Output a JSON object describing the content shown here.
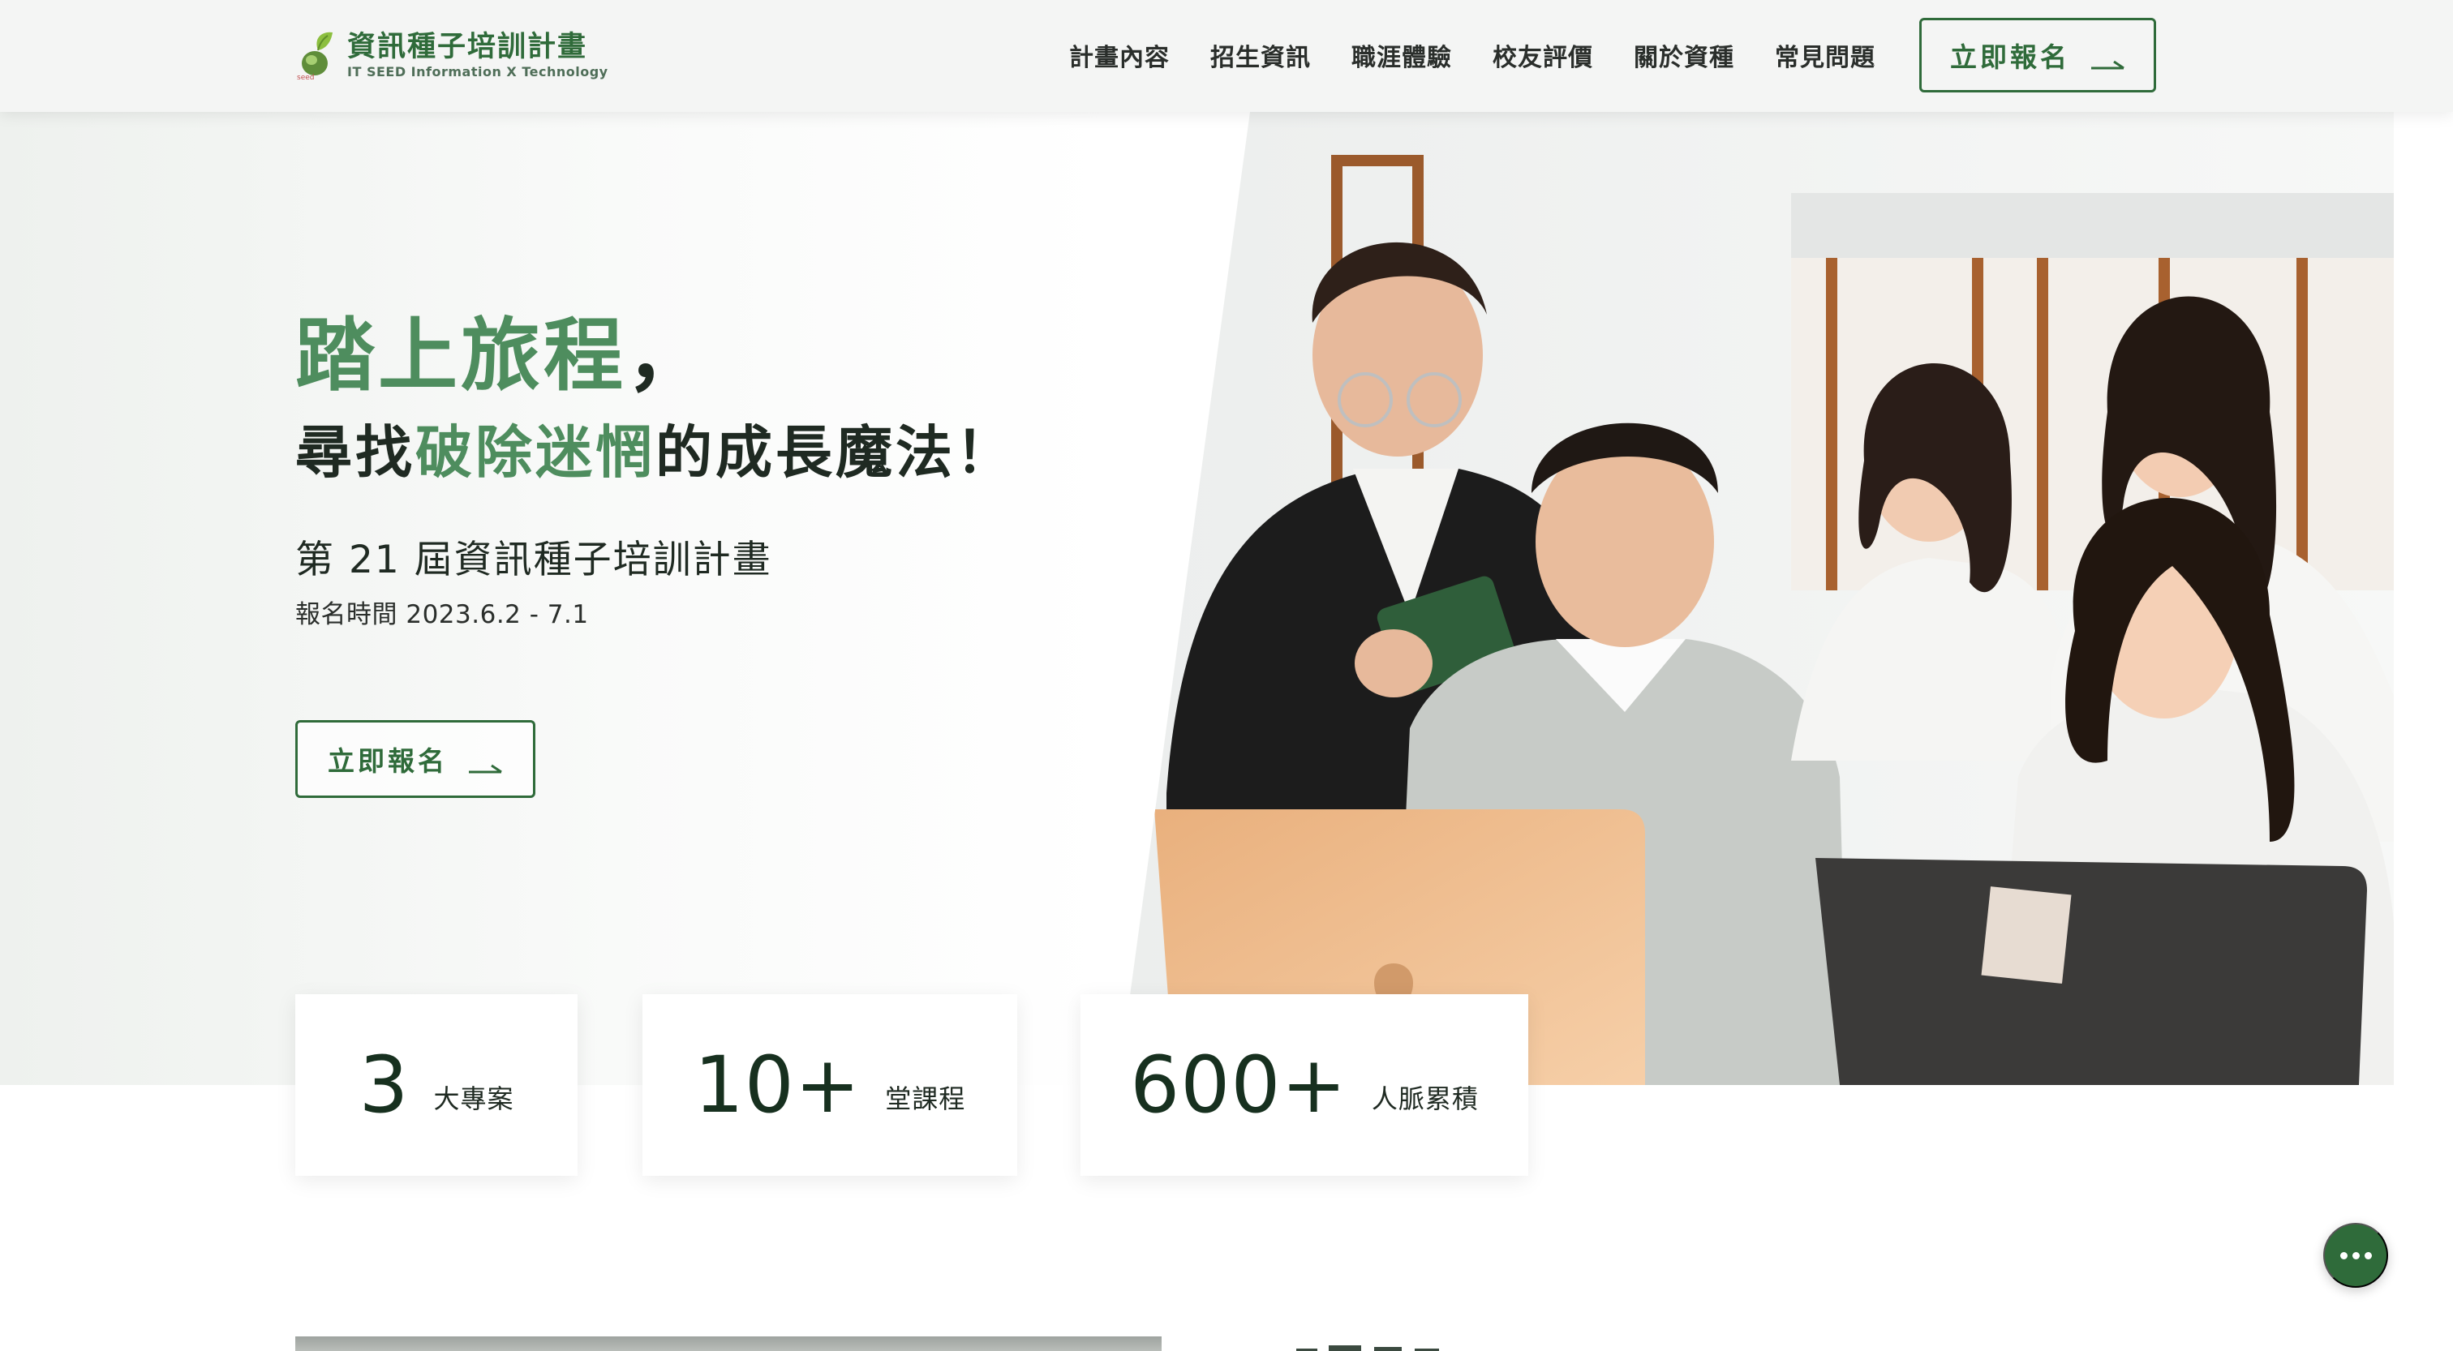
{
  "colors": {
    "brand_green": "#2f6b3a",
    "accent_green": "#4e8d5e",
    "text_dark": "#1f2a22"
  },
  "nav": {
    "logo_title": "資訊種子培訓計畫",
    "logo_subtitle": "IT SEED  Information X Technology",
    "items": [
      "計畫內容",
      "招生資訊",
      "職涯體驗",
      "校友評價",
      "關於資種",
      "常見問題"
    ],
    "cta_label": "立即報名",
    "cta_icon": "arrow-right-icon"
  },
  "hero": {
    "headline_line1": "踏上旅程",
    "headline_line1_punct": "，",
    "headline_line2_pre": "尋找",
    "headline_line2_accent": "破除迷惘",
    "headline_line2_post": "的成長魔法！",
    "program_title": "第 21 屆資訊種子培訓計畫",
    "registration_period": "報名時間 2023.6.2 - 7.1",
    "cta_label": "立即報名",
    "cta_icon": "arrow-right-icon",
    "photo_icon": "students-with-laptops-photo"
  },
  "stats": [
    {
      "number": "3",
      "label": "大專案"
    },
    {
      "number": "10+",
      "label": "堂課程"
    },
    {
      "number": "600+",
      "label": "人脈累積"
    }
  ],
  "chat": {
    "icon": "more-dots-icon"
  }
}
